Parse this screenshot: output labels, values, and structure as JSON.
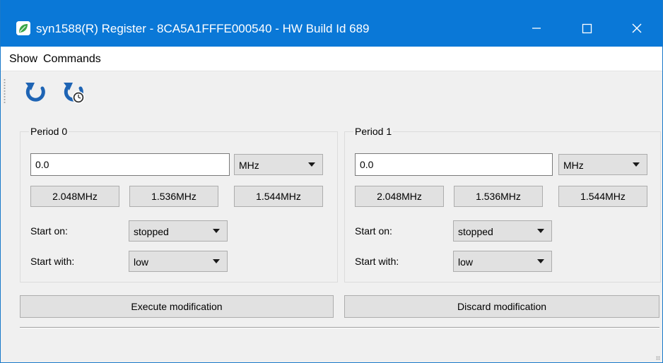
{
  "window": {
    "title": "syn1588(R) Register - 8CA5A1FFFE000540 - HW Build Id 689",
    "app_icon": "leaf-icon",
    "controls": [
      "minimize-icon",
      "maximize-icon",
      "close-icon"
    ]
  },
  "menu": {
    "items": [
      {
        "label": "Show"
      },
      {
        "label": "Commands"
      }
    ]
  },
  "toolbar": {
    "buttons": [
      {
        "icon": "refresh-icon"
      },
      {
        "icon": "auto-refresh-icon"
      }
    ]
  },
  "periods": [
    {
      "title": "Period 0",
      "value": "0.0",
      "unit": "MHz",
      "presets": [
        "2.048MHz",
        "1.536MHz",
        "1.544MHz"
      ],
      "start_on_label": "Start on:",
      "start_on_value": "stopped",
      "start_with_label": "Start with:",
      "start_with_value": "low"
    },
    {
      "title": "Period 1",
      "value": "0.0",
      "unit": "MHz",
      "presets": [
        "2.048MHz",
        "1.536MHz",
        "1.544MHz"
      ],
      "start_on_label": "Start on:",
      "start_on_value": "stopped",
      "start_with_label": "Start with:",
      "start_with_value": "low"
    }
  ],
  "actions": {
    "execute_label": "Execute modification",
    "discard_label": "Discard modification"
  },
  "colors": {
    "titlebar": "#0a78d7",
    "window_background": "#f0f0f0",
    "button_face": "#e1e1e1",
    "icon_blue": "#1e64b4",
    "leaf_green": "#3aa648"
  }
}
